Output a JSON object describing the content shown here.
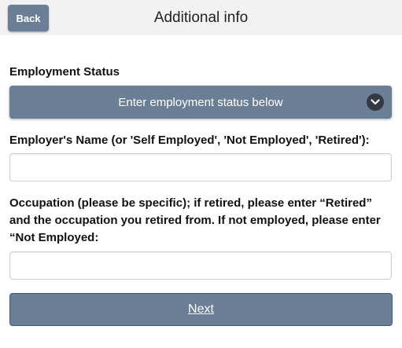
{
  "header": {
    "back_label": "Back",
    "title": "Additional info"
  },
  "employment_status": {
    "label": "Employment Status",
    "selected_value": "Enter employment status below",
    "icon": "chevron-down-icon"
  },
  "employer_name": {
    "label": "Employer's Name (or 'Self Employed', 'Not Employed', 'Retired'):",
    "value": ""
  },
  "occupation": {
    "label": "Occupation (please be specific); if retired, please enter “Retired” and the occupation you retired from. If not employed, please enter “Not Employed:",
    "value": ""
  },
  "next_label": "Next",
  "colors": {
    "header_bg": "#f2f2f2",
    "button_bg": "#6a7f96",
    "chevron_bg": "#333a42"
  }
}
